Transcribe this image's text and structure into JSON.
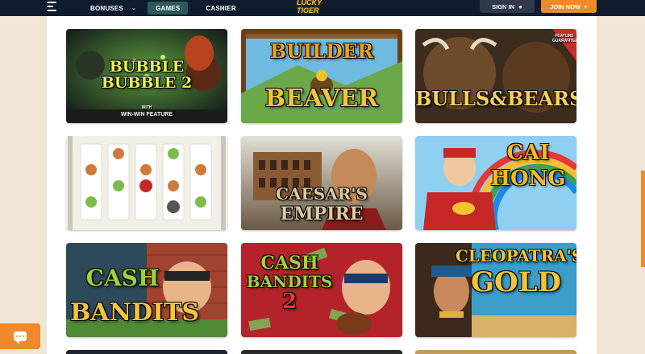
{
  "header": {
    "nav": [
      {
        "label": "BONUSES",
        "has_dropdown": true
      },
      {
        "label": "GAMES",
        "active": true
      },
      {
        "label": "CASHIER"
      }
    ],
    "logo_text": "LUCKY TIGER",
    "sign_in_label": "SIGN IN",
    "join_now_label": "JOIN NOW",
    "icons": {
      "menu": "hamburger-icon",
      "sign_in": "user-icon",
      "join": "user-plus-icon"
    }
  },
  "games": [
    {
      "title_line1": "BUBBLE",
      "title_line2": "BUBBLE 2",
      "tagline_top": "WITH",
      "tagline": "WIN-WIN FEATURE"
    },
    {
      "title_line1": "BUILDER",
      "title_line2": "BEAVER"
    },
    {
      "title_line1": "BULLS",
      "title_line2": "BEARS",
      "badge": "FEATURE GUARANTEE"
    },
    {
      "title_line1": "",
      "title_line2": "",
      "note": "reel symbols: cupcakes, cards, dice"
    },
    {
      "title_line1": "CAESAR'S",
      "title_line2": "EMPIRE"
    },
    {
      "title_line1": "CAI",
      "title_line2": "HONG"
    },
    {
      "title_line1": "CASH",
      "title_line2": "BANDITS"
    },
    {
      "title_line1": "CASH",
      "title_line2": "BANDITS",
      "number": "2"
    },
    {
      "title_line1": "CLEOPATRA'S",
      "title_line2": "GOLD"
    }
  ],
  "colors": {
    "header_bg": "#0f1c2e",
    "games_tab_bg": "#2c5a5a",
    "join_button": "#f0892a",
    "sign_in_button": "#2f3947",
    "page_bg": "#efe6d6"
  },
  "chat": {
    "icon": "chat-icon"
  }
}
